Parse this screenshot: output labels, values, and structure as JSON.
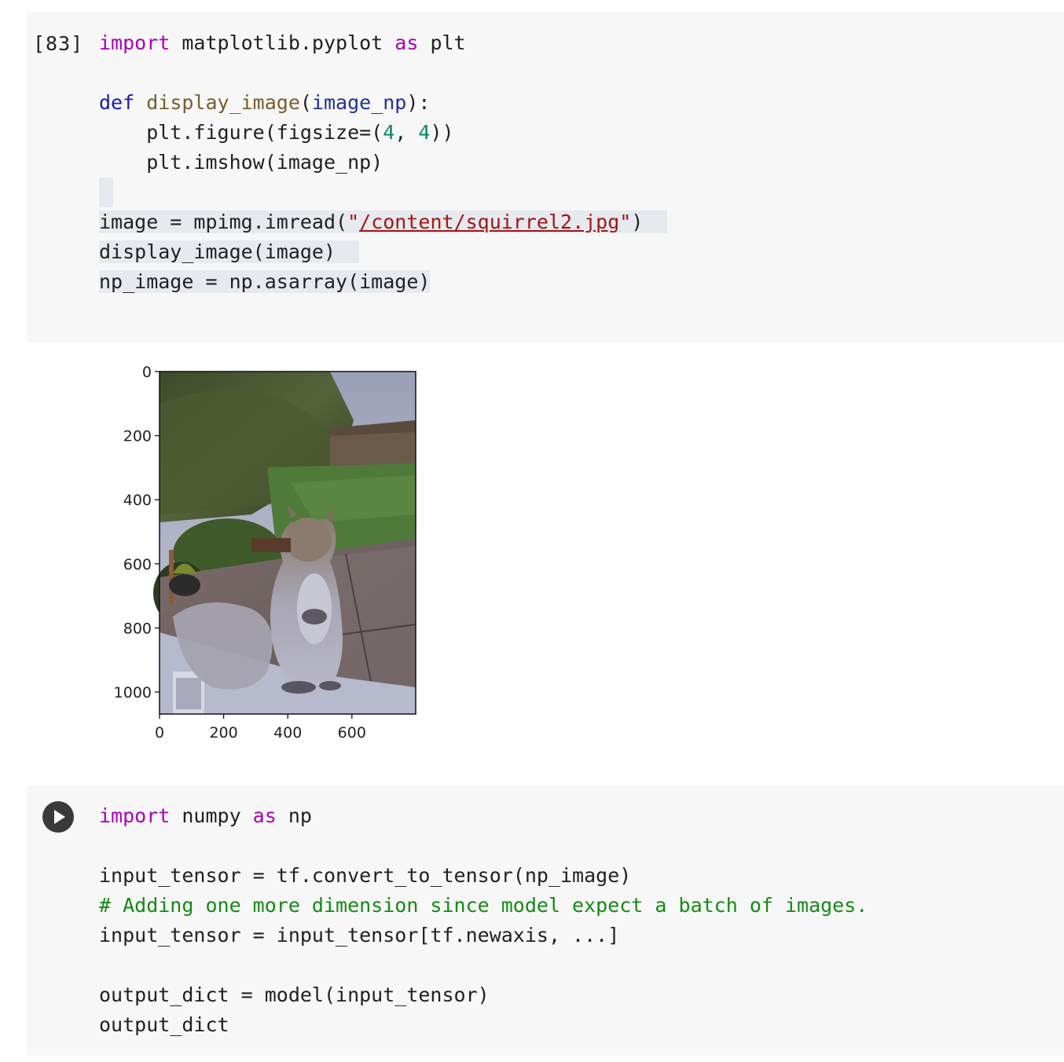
{
  "cell1": {
    "execution_count": "[83]",
    "lines": {
      "l1_kw1": "import",
      "l1_mod": " matplotlib.pyplot ",
      "l1_kw2": "as",
      "l1_alias": " plt",
      "l3_def": "def",
      "l3_sp": " ",
      "l3_fn": "display_image",
      "l3_open": "(",
      "l3_param": "image_np",
      "l3_close": "):",
      "l4_pre": "    plt.figure(figsize=(",
      "l4_n1": "4",
      "l4_mid": ", ",
      "l4_n2": "4",
      "l4_post": "))",
      "l5": "    plt.imshow(image_np)",
      "l7_pre": "image = mpimg.imread(",
      "l7_q1": "\"",
      "l7_path": "/content/squirrel2.jpg",
      "l7_q2": "\"",
      "l7_post": ")",
      "l8": "display_image(image)",
      "l9": "np_image = np.asarray(image)"
    }
  },
  "output": {
    "image_subject": "squirrel-photo",
    "y_ticks": [
      "0",
      "200",
      "400",
      "600",
      "800",
      "1000"
    ],
    "x_ticks": [
      "0",
      "200",
      "400",
      "600"
    ]
  },
  "cell2": {
    "run_icon": "play-icon",
    "lines": {
      "l1_kw1": "import",
      "l1_mod": " numpy ",
      "l1_kw2": "as",
      "l1_alias": " np",
      "l3": "input_tensor = tf.convert_to_tensor(np_image)",
      "l4": "# Adding one more dimension since model expect a batch of images.",
      "l5": "input_tensor = input_tensor[tf.newaxis, ...]",
      "l7": "output_dict = model(input_tensor)",
      "l8": "output_dict"
    }
  }
}
